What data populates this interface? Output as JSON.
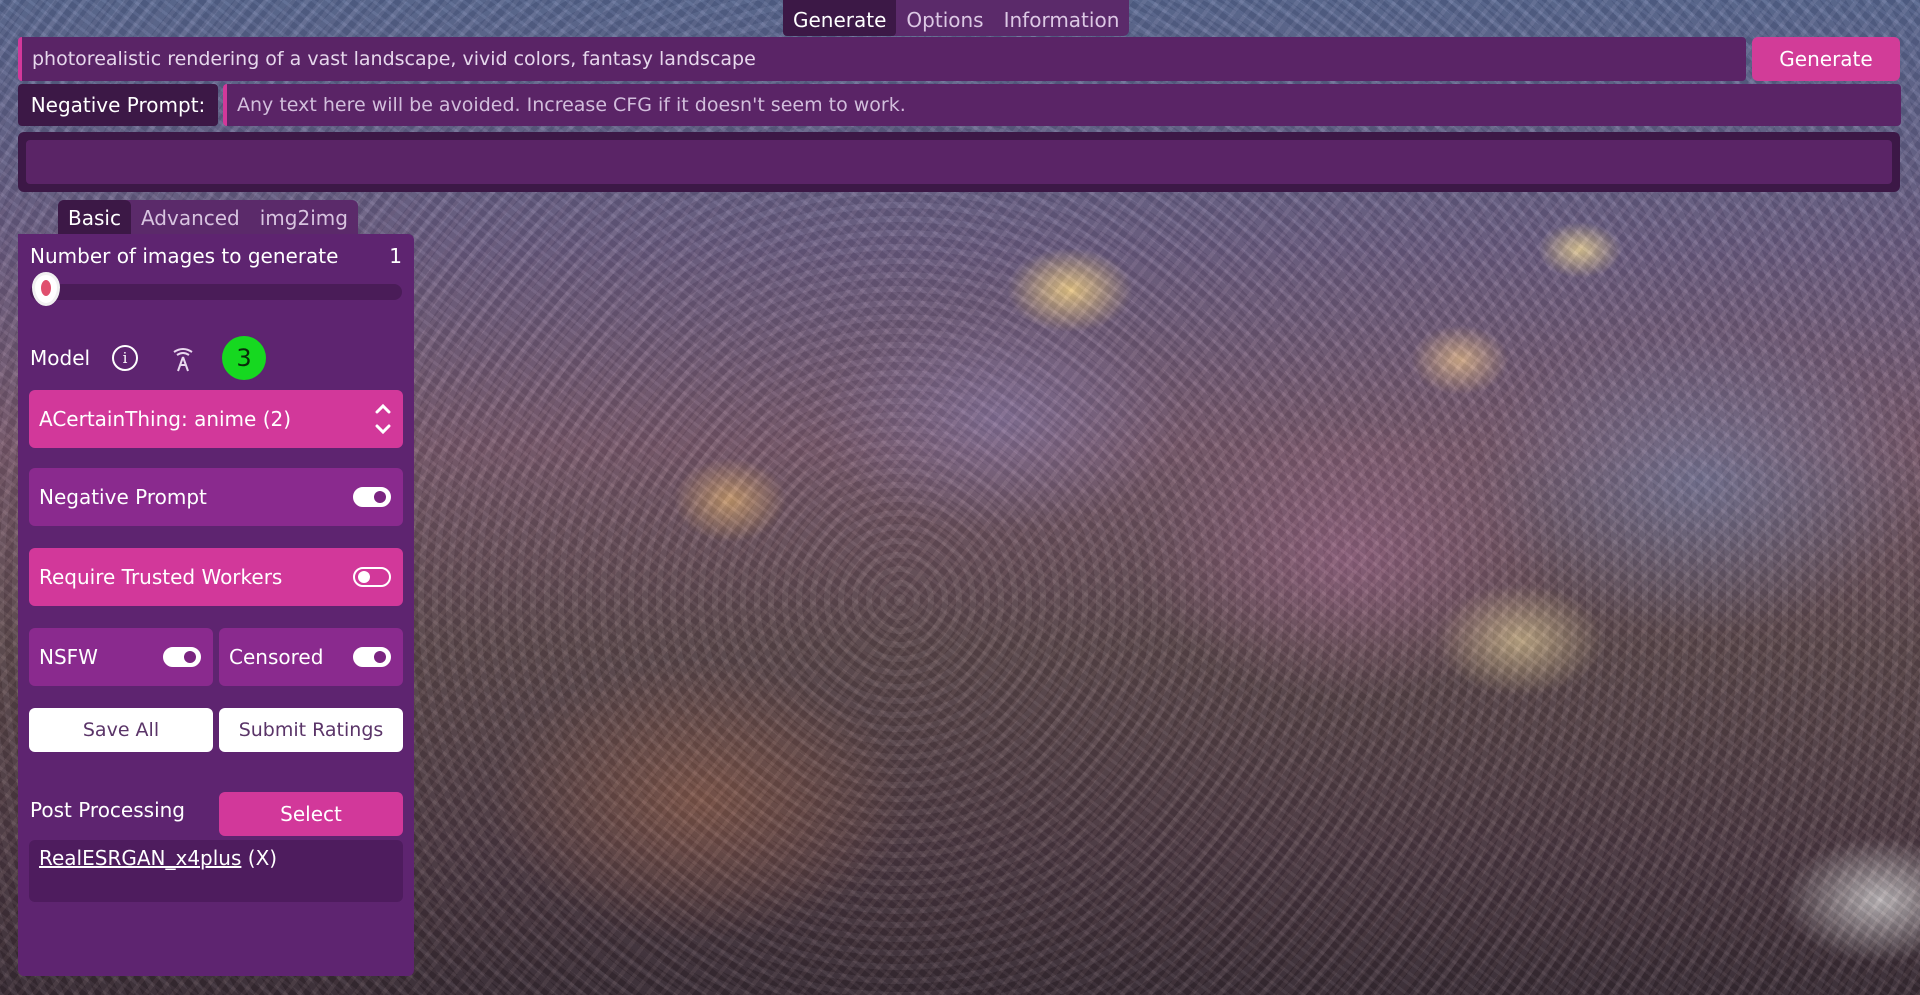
{
  "top_tabs": [
    {
      "label": "Generate",
      "active": true
    },
    {
      "label": "Options",
      "active": false
    },
    {
      "label": "Information",
      "active": false
    }
  ],
  "prompt": {
    "value": "photorealistic rendering of a vast landscape, vivid colors, fantasy landscape"
  },
  "generate_button": "Generate",
  "negative_prompt": {
    "label": "Negative Prompt:",
    "placeholder": "Any text here will be avoided. Increase CFG if it doesn't seem to work."
  },
  "progress": {
    "fraction": 0
  },
  "panel_tabs": [
    {
      "label": "Basic",
      "active": true
    },
    {
      "label": "Advanced",
      "active": false
    },
    {
      "label": "img2img",
      "active": false
    }
  ],
  "panel": {
    "num_images": {
      "label": "Number of images to generate",
      "value": "1",
      "slider_fraction": 0.0
    },
    "model": {
      "label": "Model",
      "info_icon": "info-icon",
      "worker_icon": "tower-icon",
      "count": "3",
      "selected": "ACertainThing: anime (2)"
    },
    "negative_prompt_toggle": {
      "label": "Negative Prompt",
      "on": true
    },
    "trusted_workers_toggle": {
      "label": "Require Trusted Workers",
      "on": false
    },
    "nsfw_toggle": {
      "label": "NSFW",
      "on": true
    },
    "censored_toggle": {
      "label": "Censored",
      "on": true
    },
    "save_all": "Save All",
    "submit_ratings": "Submit Ratings",
    "post_processing": {
      "label": "Post Processing",
      "select_label": "Select",
      "items": [
        {
          "name": "RealESRGAN_x4plus",
          "remove": "(X)"
        }
      ]
    }
  },
  "colors": {
    "accent": "#d2389a",
    "panel": "#5e2470",
    "dark": "#3c1846",
    "badge": "#16d820"
  }
}
